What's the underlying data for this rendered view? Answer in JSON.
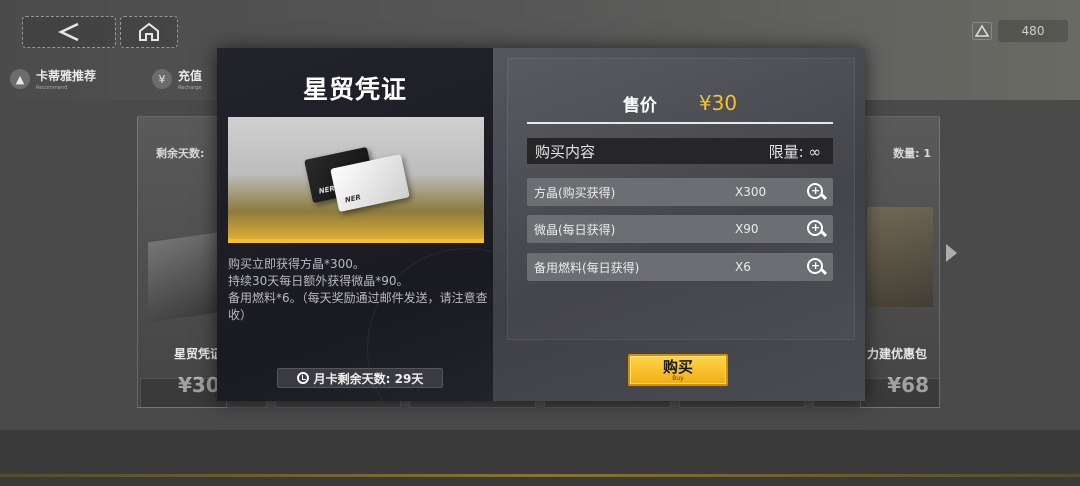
{
  "header": {
    "currency_amount": "480",
    "tabs": [
      {
        "label": "卡蒂雅推荐",
        "sub": "Recommend",
        "icon": "wolf-icon"
      },
      {
        "label": "充值",
        "sub": "Recharge",
        "icon": "yen-icon"
      }
    ]
  },
  "background_packs": {
    "left": {
      "corner": "剩余天数:",
      "name": "星贸凭证",
      "price": "¥30"
    },
    "right": {
      "corner": "数量: 1",
      "name": "力建优惠包",
      "price": "¥68"
    }
  },
  "modal": {
    "title": "星贸凭证",
    "description": [
      "购买立即获得方晶*300。",
      "持续30天每日额外获得微晶*90。",
      "备用燃料*6。（每天奖励通过邮件发送，请注意查收）"
    ],
    "remaining_days": "月卡剩余天数: 29天",
    "price_label": "售价",
    "price_value": "¥30",
    "content_title": "购买内容",
    "limit": "限量: ∞",
    "rewards": [
      {
        "name": "方晶(购买获得)",
        "qty": "X300"
      },
      {
        "name": "微晶(每日获得)",
        "qty": "X90"
      },
      {
        "name": "备用燃料(每日获得)",
        "qty": "X6"
      }
    ],
    "buy_label": "购买",
    "buy_sub": "Buy",
    "card_logo": "NER"
  },
  "colors": {
    "accent_gold": "#f4c12e",
    "modal_left_bg": "#1f1f26",
    "modal_right_bg": "#4a4c51",
    "reward_row_bg": "#6c6e73"
  }
}
